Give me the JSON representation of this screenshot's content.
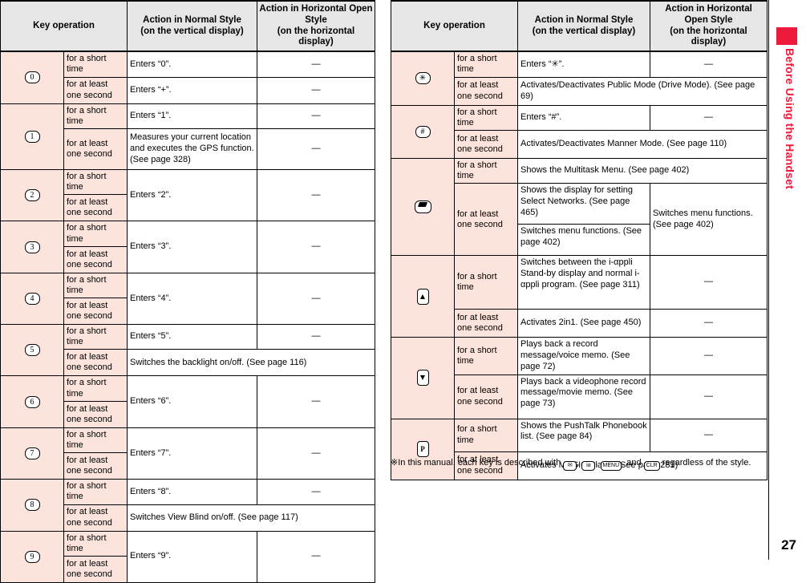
{
  "header": {
    "col_key": "Key operation",
    "col_normal_l1": "Action in Normal Style",
    "col_normal_l2": "(on the vertical display)",
    "col_horizontal_l1": "Action in Horizontal Open Style",
    "col_horizontal_l2": "(on the horizontal display)"
  },
  "labels": {
    "short": "for a short time",
    "long": "for at least one second",
    "dash": "—"
  },
  "colors": {
    "key_cell_bg": "#fce4dc",
    "header_bg": "#e6e6e6",
    "tab_red": "#ed1a3b",
    "border": "#000000"
  },
  "left_table": {
    "rows": [
      {
        "key": "0",
        "key_icon": "key-0-icon",
        "short": {
          "normal": "Enters “0”.",
          "horizontal": "—"
        },
        "long": {
          "normal": "Enters “+”.",
          "horizontal": "—"
        },
        "merge_normal": false
      },
      {
        "key": "1",
        "key_icon": "key-1-icon",
        "short": {
          "normal": "Enters “1”.",
          "horizontal": "—"
        },
        "long": {
          "normal": "Measures your current location and executes the GPS function. (See page 328)",
          "horizontal": "—"
        },
        "merge_normal": false
      },
      {
        "key": "2",
        "key_icon": "key-2-icon",
        "combined": {
          "normal": "Enters “2”.",
          "horizontal": "—"
        }
      },
      {
        "key": "3",
        "key_icon": "key-3-icon",
        "combined": {
          "normal": "Enters “3”.",
          "horizontal": "—"
        }
      },
      {
        "key": "4",
        "key_icon": "key-4-icon",
        "combined": {
          "normal": "Enters “4”.",
          "horizontal": "—"
        }
      },
      {
        "key": "5",
        "key_icon": "key-5-icon",
        "short": {
          "normal": "Enters “5”.",
          "horizontal": "—"
        },
        "long_fullspan": "Switches the backlight on/off. (See page 116)"
      },
      {
        "key": "6",
        "key_icon": "key-6-icon",
        "combined": {
          "normal": "Enters “6”.",
          "horizontal": "—"
        }
      },
      {
        "key": "7",
        "key_icon": "key-7-icon",
        "combined": {
          "normal": "Enters “7”.",
          "horizontal": "—"
        }
      },
      {
        "key": "8",
        "key_icon": "key-8-icon",
        "short": {
          "normal": "Enters “8”.",
          "horizontal": "—"
        },
        "long_fullspan": "Switches View Blind on/off. (See page 117)"
      },
      {
        "key": "9",
        "key_icon": "key-9-icon",
        "combined": {
          "normal": "Enters “9”.",
          "horizontal": "—"
        }
      }
    ]
  },
  "right_table": {
    "rows": [
      {
        "key": "✳",
        "key_icon": "key-asterisk-icon",
        "short": {
          "normal": "Enters “✳”.",
          "horizontal": "—"
        },
        "long_fullspan": "Activates/Deactivates Public Mode (Drive Mode). (See page 69)"
      },
      {
        "key": "#",
        "key_icon": "key-hash-icon",
        "short": {
          "normal": "Enters “#”.",
          "horizontal": "—"
        },
        "long_fullspan": "Activates/Deactivates Manner Mode. (See page 110)"
      },
      {
        "key": "multitask",
        "key_icon": "key-multitask-icon",
        "short_fullspan": "Shows the Multitask Menu. (See page 402)",
        "long_normal_a": "Shows the display for setting Select Networks. (See page 465)",
        "long_normal_b": "Switches menu functions. (See page 402)",
        "long_horizontal": "Switches menu functions. (See page 402)"
      },
      {
        "key": "up",
        "key_icon": "key-up-arrow-icon",
        "short": {
          "normal": "Switches between the i-αppli Stand-by display and normal i-αppli program. (See page 311)",
          "horizontal": "—"
        },
        "long": {
          "normal": "Activates 2in1. (See page 450)",
          "horizontal": "—"
        }
      },
      {
        "key": "down",
        "key_icon": "key-down-arrow-icon",
        "short": {
          "normal": "Plays back a record message/voice memo. (See page 72)",
          "horizontal": "—"
        },
        "long": {
          "normal": "Plays back a videophone record message/movie memo. (See page 73)",
          "horizontal": "—"
        }
      },
      {
        "key": "pushtalk",
        "key_icon": "key-pushtalk-icon",
        "short": {
          "normal": "Shows the PushTalk Phonebook list. (See page 84)",
          "horizontal": "—"
        },
        "long_fullspan": "Activates MUSIC Player (See page 281)"
      }
    ]
  },
  "footnote": {
    "mark": "※",
    "part1": "In this manual, each key is described with ",
    "key1": "✉",
    "sep1": ", ",
    "key2": "iα",
    "sep2": ", ",
    "key3": "MENU",
    "sep3": ", and ",
    "key4": "CLR",
    "part2": " regardless of the style."
  },
  "sidebar": {
    "tab_label": "Before Using the Handset"
  },
  "page_number": "27"
}
